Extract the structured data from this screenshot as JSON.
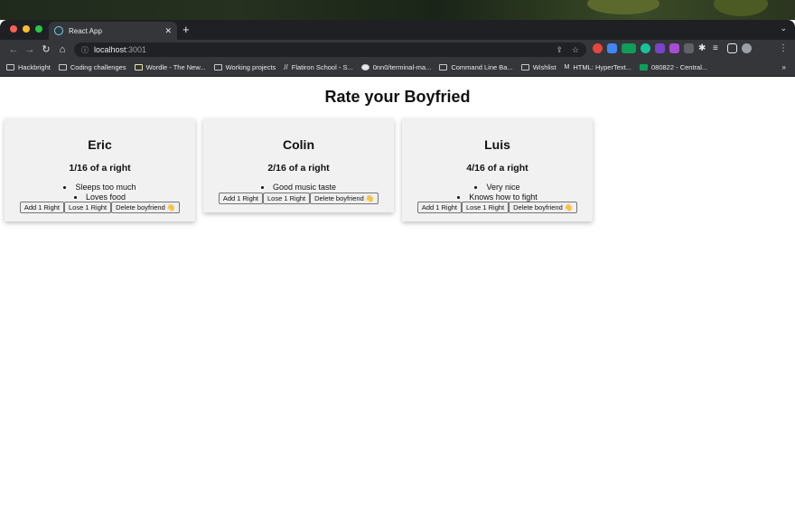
{
  "browser": {
    "tab_title": "React App",
    "url_host": "localhost",
    "url_port": ":3001",
    "bookmarks": [
      "Hackbright",
      "Coding challenges",
      "Wordle - The New...",
      "Working projects",
      "Flatiron School - S...",
      "0nn0/terminal-ma...",
      "Command Line Ba...",
      "Wishlist",
      "HTML: HyperText...",
      "080822 - Central..."
    ],
    "bookmarks_more": "»"
  },
  "page": {
    "title": "Rate your Boyfried"
  },
  "cards": [
    {
      "name": "Eric",
      "score": "1/16 of a right",
      "traits": [
        "Sleeps too much",
        "Loves food"
      ],
      "add_label": "Add 1 Right",
      "lose_label": "Lose 1 Right",
      "delete_label": "Delete boyfriend 👋"
    },
    {
      "name": "Colin",
      "score": "2/16 of a right",
      "traits": [
        "Good music taste"
      ],
      "add_label": "Add 1 Right",
      "lose_label": "Lose 1 Right",
      "delete_label": "Delete boyfriend 👋"
    },
    {
      "name": "Luis",
      "score": "4/16 of a right",
      "traits": [
        "Very nice",
        "Knows how to fight"
      ],
      "add_label": "Add 1 Right",
      "lose_label": "Lose 1 Right",
      "delete_label": "Delete boyfriend 👋"
    }
  ],
  "colors": {
    "chrome_dark": "#35363a",
    "tabbar_bg": "#1f2023",
    "card_bg": "#f1f1f1"
  }
}
